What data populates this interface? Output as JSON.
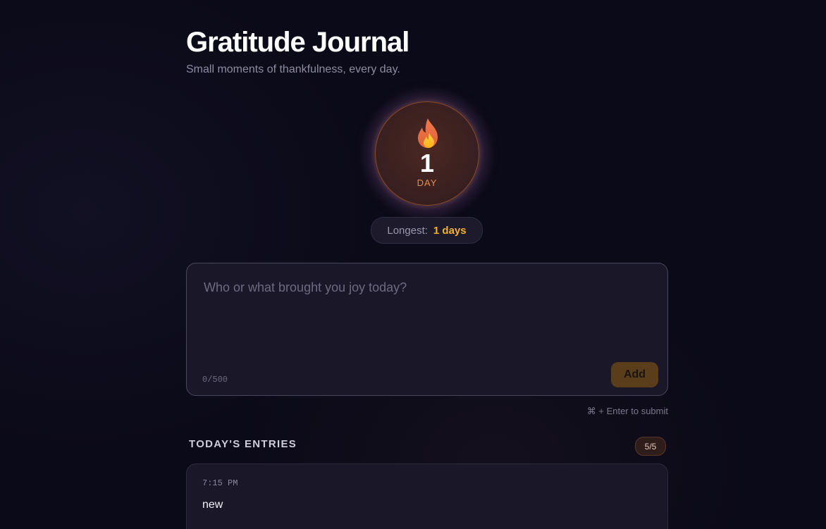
{
  "header": {
    "title": "Gratitude Journal",
    "subtitle": "Small moments of thankfulness, every day."
  },
  "streak": {
    "icon": "flame-icon",
    "count": "1",
    "unit": "DAY",
    "longest_label": "Longest:",
    "longest_value": "1 days"
  },
  "composer": {
    "placeholder": "Who or what brought you joy today?",
    "value": "",
    "char_count": "0/500",
    "add_label": "Add",
    "hint": "⌘ + Enter to submit"
  },
  "entries": {
    "section_title": "TODAY'S ENTRIES",
    "count_badge": "5/5",
    "items": [
      {
        "time": "7:15 PM",
        "text": "new"
      }
    ]
  },
  "colors": {
    "background": "#0b0a18",
    "accent_gold": "#f5b325",
    "accent_orange": "#e88a4a",
    "card": "#1a1828"
  }
}
